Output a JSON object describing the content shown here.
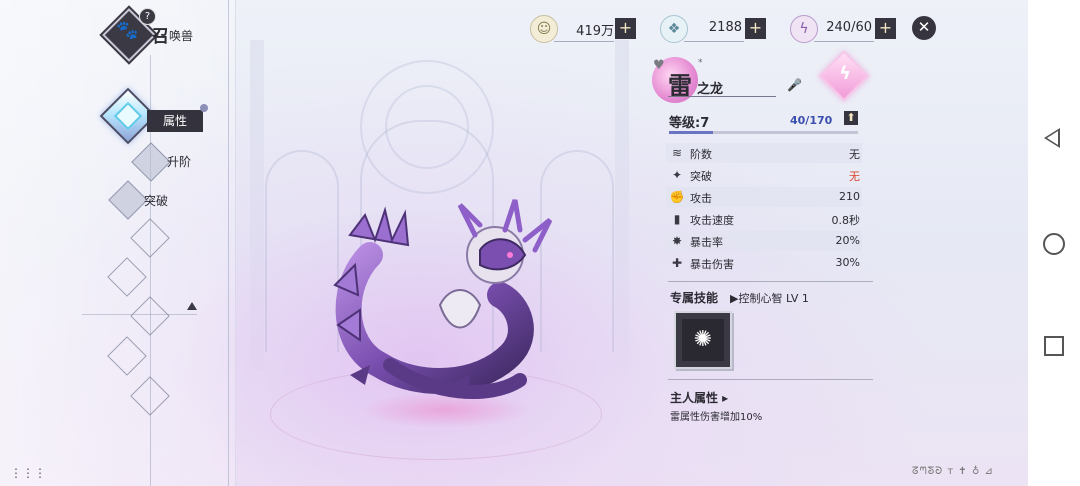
{
  "header": {
    "title_big": "召",
    "title_small": "唤兽",
    "help_mark": "?",
    "logo_icon": "paw-icon"
  },
  "side_tabs": [
    {
      "label": "属性",
      "active": true
    },
    {
      "label": "升阶",
      "active": false
    },
    {
      "label": "突破",
      "active": false
    }
  ],
  "resources": [
    {
      "name": "gold",
      "icon": "coin-icon",
      "value": "419万",
      "plus": "+"
    },
    {
      "name": "crystal",
      "icon": "crystal-icon",
      "value": "2188",
      "plus": "+"
    },
    {
      "name": "stamina",
      "icon": "energy-icon",
      "value": "240/60",
      "plus": "+"
    }
  ],
  "close_label": "✕",
  "beast": {
    "name_big": "雷",
    "name_small": "之龙",
    "star_mark": "*",
    "element_symbol": "ϟ",
    "level_label": "等级:7",
    "exp_text": "40/170",
    "exp_fraction": 0.235,
    "level_up_symbol": "⬆"
  },
  "stats": [
    {
      "icon": "layers-icon",
      "glyph": "≋",
      "name": "阶数",
      "value": "无",
      "highlight": false
    },
    {
      "icon": "break-icon",
      "glyph": "✦",
      "name": "突破",
      "value": "无",
      "highlight": true
    },
    {
      "icon": "fist-icon",
      "glyph": "✊",
      "name": "攻击",
      "value": "210",
      "highlight": false
    },
    {
      "icon": "bars-icon",
      "glyph": "▮",
      "name": "攻击速度",
      "value": "0.8秒",
      "highlight": false
    },
    {
      "icon": "crit-icon",
      "glyph": "✸",
      "name": "暴击率",
      "value": "20%",
      "highlight": false
    },
    {
      "icon": "crit-dmg-icon",
      "glyph": "✚",
      "name": "暴击伤害",
      "value": "30%",
      "highlight": false
    }
  ],
  "skill": {
    "title": "专属技能",
    "name": "▶控制心智 LV 1",
    "icon_glyph": "✺"
  },
  "owner": {
    "title": "主人属性 ▸",
    "desc": "雷属性伤害增加10%"
  },
  "deco_text": "ᘔᘉᘕᘐ ᴛ ✝ ♁ ⊿",
  "colors": {
    "accent_dark": "#36353f",
    "exp_blue": "#3a4fae",
    "red_value": "#d8452b",
    "element_pink": "#e58ad2"
  }
}
